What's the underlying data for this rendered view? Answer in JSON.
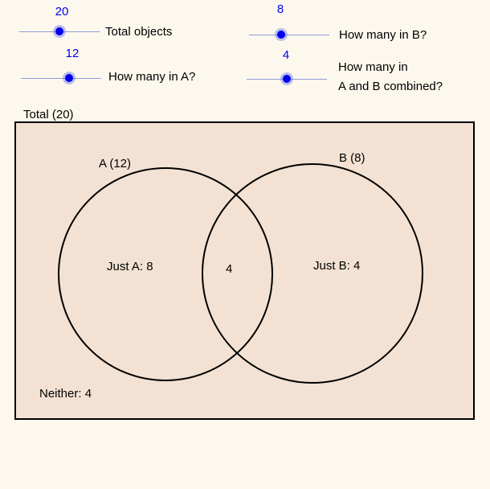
{
  "sliders": {
    "total": {
      "value": "20",
      "label": "Total objects"
    },
    "b": {
      "value": "8",
      "label": "How many in B?"
    },
    "a": {
      "value": "12",
      "label": "How many in A?"
    },
    "ab": {
      "value": "4",
      "label_line1": "How many in",
      "label_line2": "A and B combined?"
    }
  },
  "venn": {
    "total_label": "Total (20)",
    "a_label": "A (12)",
    "b_label": "B (8)",
    "just_a": "Just A:  8",
    "intersection": "4",
    "just_b": "Just B:  4",
    "neither": "Neither:  4",
    "colors": {
      "box_fill": "#f3e2d3",
      "stroke": "#000000",
      "slider_knob": "#0000ee",
      "background": "#fdf8ed"
    }
  }
}
